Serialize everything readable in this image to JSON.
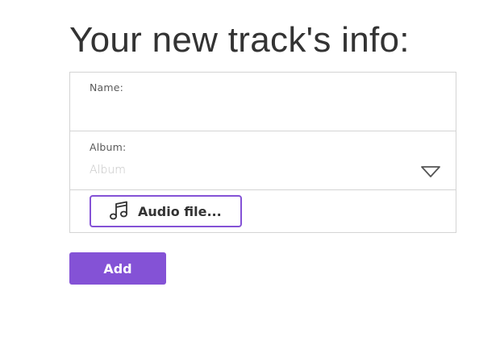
{
  "page": {
    "title": "Your new track's info:"
  },
  "form": {
    "name": {
      "label": "Name:",
      "value": ""
    },
    "album": {
      "label": "Album:",
      "placeholder": "Album",
      "icon": "dropdown-triangle-icon"
    },
    "audio_file": {
      "label": "Audio file...",
      "icon": "music-note-icon"
    }
  },
  "actions": {
    "add_label": "Add"
  },
  "colors": {
    "accent": "#8452d6",
    "border": "#d4d4d4",
    "text": "#333333",
    "placeholder": "#c4c4c4"
  }
}
